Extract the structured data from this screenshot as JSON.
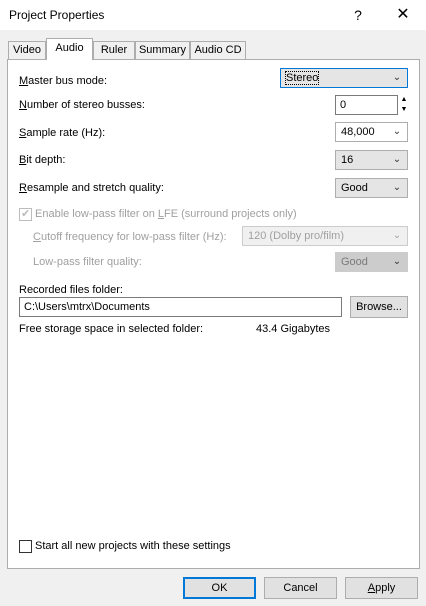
{
  "window": {
    "title": "Project Properties",
    "help_glyph": "?",
    "close_glyph": "✕"
  },
  "tabs": [
    {
      "label": "Video",
      "active": false
    },
    {
      "label": "Audio",
      "active": true
    },
    {
      "label": "Ruler",
      "active": false
    },
    {
      "label": "Summary",
      "active": false
    },
    {
      "label": "Audio CD",
      "active": false
    }
  ],
  "audio": {
    "master_bus_mode": {
      "u": "M",
      "rest": "aster bus mode:",
      "value": "Stereo"
    },
    "stereo_busses": {
      "u": "N",
      "rest": "umber of stereo busses:",
      "value": "0"
    },
    "sample_rate": {
      "u": "S",
      "rest": "ample rate (Hz):",
      "value": "48,000"
    },
    "bit_depth": {
      "u": "B",
      "rest": "it depth:",
      "value": "16"
    },
    "resample_quality": {
      "u": "R",
      "rest": "esample and stretch quality:",
      "value": "Good"
    },
    "lowpass_enable": {
      "pre": "Enable low-pass filter on ",
      "u": "L",
      "rest": "FE (surround projects only)",
      "checked": true
    },
    "cutoff_freq": {
      "u": "C",
      "rest": "utoff frequency for low-pass filter (Hz):",
      "value": "120 (Dolby pro/film)"
    },
    "lowpass_quality": {
      "label": "Low-pass filter quality:",
      "value": "Good"
    },
    "recorded_folder": {
      "label": "Recorded files folder:",
      "value": "C:\\Users\\mtrx\\Documents",
      "browse": "Browse..."
    },
    "free_storage": {
      "label": "Free storage space in selected folder:",
      "value": "43.4 Gigabytes"
    },
    "start_all": {
      "label": "Start all new projects with these settings",
      "checked": false
    }
  },
  "buttons": {
    "ok": "OK",
    "cancel": "Cancel",
    "apply_u": "A",
    "apply_rest": "pply"
  },
  "icons": {
    "dropdown": "chevron-down-icon",
    "spin_up": "▲",
    "spin_down": "▼",
    "check": "✔"
  }
}
